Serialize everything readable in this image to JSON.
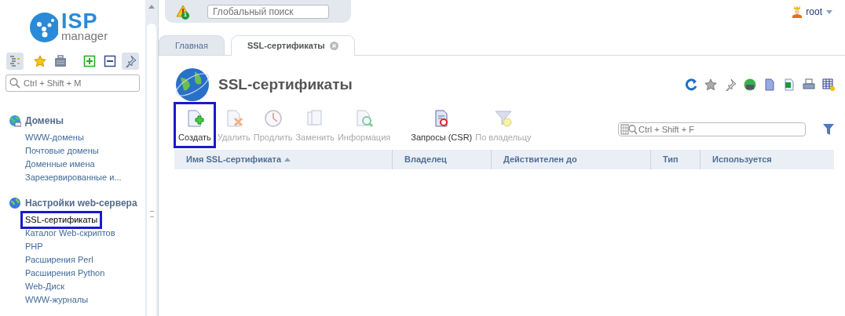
{
  "logo": {
    "top": "ISP",
    "bottom": "manager"
  },
  "sidebar": {
    "search_placeholder": "Ctrl + Shift + M",
    "sections": [
      {
        "title": "Домены",
        "items": [
          {
            "label": "WWW-домены",
            "selected": false,
            "highlighted": false
          },
          {
            "label": "Почтовые домены",
            "selected": false,
            "highlighted": false
          },
          {
            "label": "Доменные имена",
            "selected": false,
            "highlighted": false
          },
          {
            "label": "Зарезервированные и...",
            "selected": false,
            "highlighted": false
          }
        ]
      },
      {
        "title": "Настройки web-сервера",
        "items": [
          {
            "label": "SSL-сертификаты",
            "selected": true,
            "highlighted": true
          },
          {
            "label": "Каталог Web-скриптов",
            "selected": false,
            "highlighted": false
          },
          {
            "label": "PHP",
            "selected": false,
            "highlighted": false
          },
          {
            "label": "Расширения Perl",
            "selected": false,
            "highlighted": false
          },
          {
            "label": "Расширения Python",
            "selected": false,
            "highlighted": false
          },
          {
            "label": "Web-Диск",
            "selected": false,
            "highlighted": false
          },
          {
            "label": "WWW-журналы",
            "selected": false,
            "highlighted": false
          }
        ]
      }
    ]
  },
  "topbar": {
    "notification_count": "1",
    "search_placeholder": "Глобальный поиск",
    "user": "root"
  },
  "tabs": [
    {
      "label": "Главная",
      "selected": false,
      "closable": false
    },
    {
      "label": "SSL-сертификаты",
      "selected": true,
      "closable": true
    }
  ],
  "page": {
    "title": "SSL-сертификаты"
  },
  "toolbar": [
    {
      "label": "Создать",
      "disabled": false,
      "highlighted": true
    },
    {
      "label": "Удалить",
      "disabled": true,
      "highlighted": false
    },
    {
      "label": "Продлить",
      "disabled": true,
      "highlighted": false
    },
    {
      "label": "Заменить",
      "disabled": true,
      "highlighted": false
    },
    {
      "label": "Информация",
      "disabled": true,
      "highlighted": false
    },
    {
      "label": "Запросы (CSR)",
      "disabled": false,
      "highlighted": false
    },
    {
      "label": "По владельцу",
      "disabled": true,
      "highlighted": false
    }
  ],
  "filter": {
    "placeholder": "Ctrl + Shift + F"
  },
  "table": {
    "columns": [
      {
        "label": "Имя SSL-сертификата",
        "sorted": true
      },
      {
        "label": "Владелец",
        "sorted": false
      },
      {
        "label": "Действителен до",
        "sorted": false
      },
      {
        "label": "Тип",
        "sorted": false
      },
      {
        "label": "Используется",
        "sorted": false
      }
    ]
  }
}
